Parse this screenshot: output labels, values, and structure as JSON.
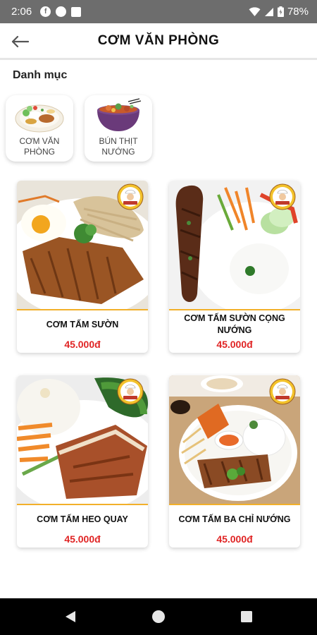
{
  "status_bar": {
    "time": "2:06",
    "battery": "78%"
  },
  "app_bar": {
    "title": "CƠM VĂN PHÒNG"
  },
  "categories": {
    "section_title": "Danh mục",
    "items": [
      {
        "label": "CƠM VĂN PHÒNG"
      },
      {
        "label": "BÚN THỊT NƯỚNG"
      }
    ]
  },
  "products": [
    {
      "name": "CƠM TẤM SƯỜN",
      "price": "45.000đ"
    },
    {
      "name": "CƠM TẤM SƯỜN CỌNG NƯỚNG",
      "price": "45.000đ"
    },
    {
      "name": "CƠM TẤM HEO QUAY",
      "price": "45.000đ"
    },
    {
      "name": "CƠM TẤM BA CHỈ NƯỚNG",
      "price": "45.000đ"
    }
  ],
  "colors": {
    "price": "#e02424",
    "accent_line": "#f2b02a",
    "status_bar": "#6d6d6d"
  }
}
